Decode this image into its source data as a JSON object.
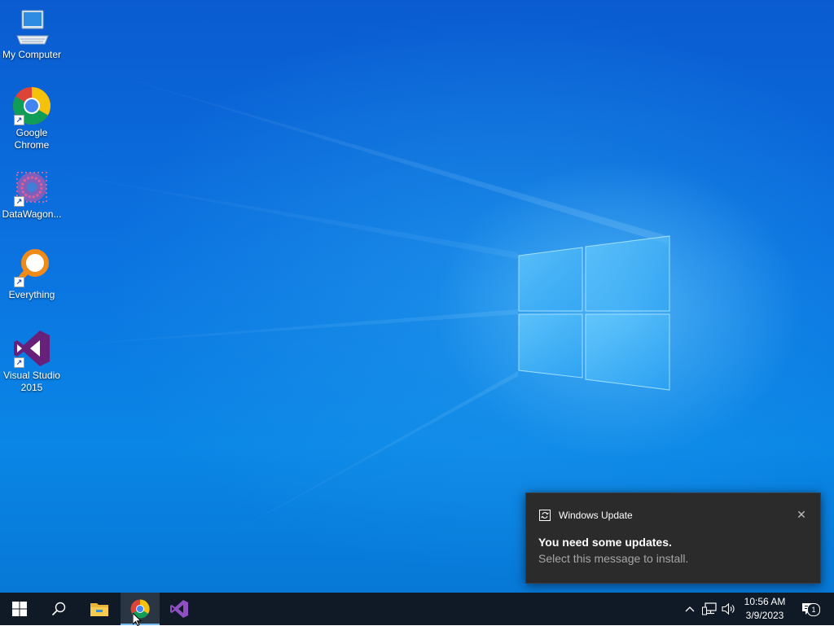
{
  "desktop": {
    "icons": [
      {
        "label": "My Computer",
        "icon": "computer-icon"
      },
      {
        "label": "Google Chrome",
        "icon": "chrome-icon"
      },
      {
        "label": "DataWagon...",
        "icon": "datawagon-icon"
      },
      {
        "label": "Everything",
        "icon": "everything-search-icon"
      },
      {
        "label": "Visual Studio 2015",
        "icon": "visual-studio-icon"
      }
    ],
    "shortcut_overlay_glyph": "↗"
  },
  "notification": {
    "app_name": "Windows Update",
    "app_icon": "sync-icon",
    "title": "You need some updates.",
    "body": "Select this message to install.",
    "close_glyph": "✕"
  },
  "taskbar": {
    "start_icon": "windows-logo-icon",
    "search_icon": "search-icon",
    "pinned": [
      {
        "name": "file-explorer",
        "icon": "folder-icon",
        "active": false
      },
      {
        "name": "google-chrome",
        "icon": "chrome-icon",
        "active": true
      },
      {
        "name": "visual-studio",
        "icon": "visual-studio-icon",
        "active": false
      }
    ],
    "tray": {
      "overflow_glyph": "^",
      "network_icon": "network-icon",
      "volume_icon": "volume-icon",
      "time": "10:56 AM",
      "date": "3/9/2023",
      "notification_count": "1"
    }
  },
  "colors": {
    "desktop_blue": "#0b74e0",
    "taskbar": "#101a26",
    "toast_bg": "#2b2b2b",
    "toast_secondary_text": "#a6a6a6",
    "active_indicator": "#76b9ed"
  }
}
